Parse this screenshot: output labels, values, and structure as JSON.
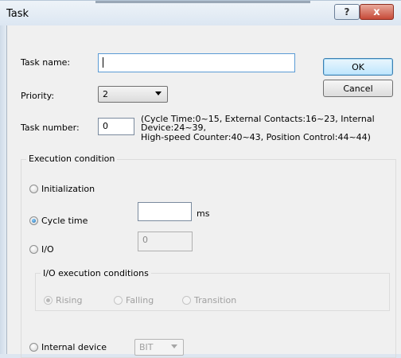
{
  "window": {
    "title": "Task",
    "help_label": "?",
    "close_label": "x"
  },
  "form": {
    "task_name_label": "Task name:",
    "task_name_value": "",
    "priority_label": "Priority:",
    "priority_value": "2",
    "task_number_label": "Task number:",
    "task_number_value": "0",
    "task_number_hint_line1": "(Cycle Time:0~15, External Contacts:16~23, Internal",
    "task_number_hint_line2": "Device:24~39,",
    "task_number_hint_line3": "High-speed Counter:40~43, Position Control:44~44)"
  },
  "buttons": {
    "ok": "OK",
    "cancel": "Cancel"
  },
  "execution": {
    "group_title": "Execution condition",
    "initialization_label": "Initialization",
    "cycle_time_label": "Cycle time",
    "cycle_time_value": "",
    "cycle_time_unit": "ms",
    "io_label": "I/O",
    "io_value": "0",
    "io_conditions_title": "I/O execution conditions",
    "rising_label": "Rising",
    "falling_label": "Falling",
    "transition_label": "Transition",
    "internal_device_label": "Internal device",
    "internal_device_type": "BIT",
    "selected": "cycle_time"
  }
}
